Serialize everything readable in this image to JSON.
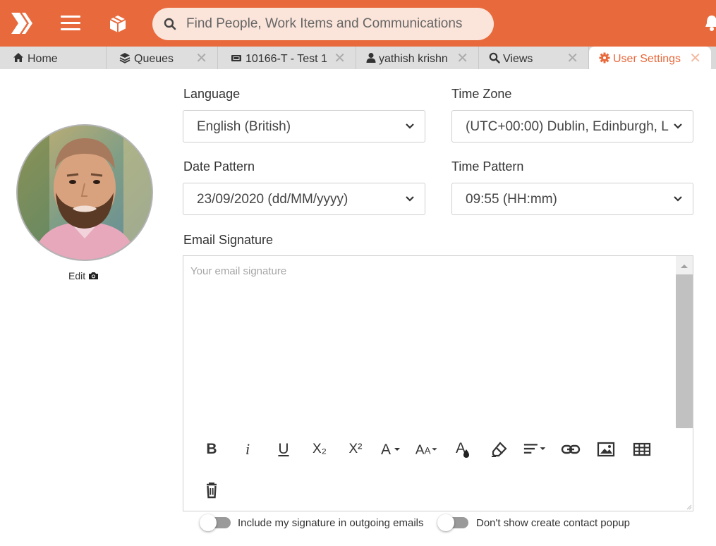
{
  "header": {
    "search_placeholder": "Find People, Work Items and Communications"
  },
  "tabs": [
    {
      "label": "Home",
      "icon": "home-icon",
      "closable": false
    },
    {
      "label": "Queues",
      "icon": "layers-icon",
      "closable": true
    },
    {
      "label": "10166-T - Test 1",
      "icon": "ticket-icon",
      "closable": true
    },
    {
      "label": "yathish krishn",
      "icon": "user-icon",
      "closable": true
    },
    {
      "label": "Views",
      "icon": "search-icon",
      "closable": true
    },
    {
      "label": "User Settings",
      "icon": "gear-icon",
      "closable": true,
      "active": true
    }
  ],
  "profile": {
    "edit_label": "Edit"
  },
  "settings": {
    "language_label": "Language",
    "language_value": "English (British)",
    "timezone_label": "Time Zone",
    "timezone_value": "(UTC+00:00) Dublin, Edinburgh, L",
    "date_pattern_label": "Date Pattern",
    "date_pattern_value": "23/09/2020 (dd/MM/yyyy)",
    "time_pattern_label": "Time Pattern",
    "time_pattern_value": "09:55 (HH:mm)",
    "email_signature_label": "Email Signature",
    "email_signature_placeholder": "Your email signature",
    "email_signature_value": ""
  },
  "toolbar": {
    "bold": "B",
    "italic": "i",
    "underline": "U",
    "subscript": "X₂",
    "superscript": "X²"
  },
  "toggles": {
    "include_signature_label": "Include my signature in outgoing emails",
    "include_signature_on": false,
    "no_contact_popup_label": "Don't show create contact popup",
    "no_contact_popup_on": false
  },
  "colors": {
    "brand": "#e8693c",
    "search_bg": "#fbe4d9",
    "tab_bg": "#dedede",
    "active_tab_text": "#e8693c"
  }
}
